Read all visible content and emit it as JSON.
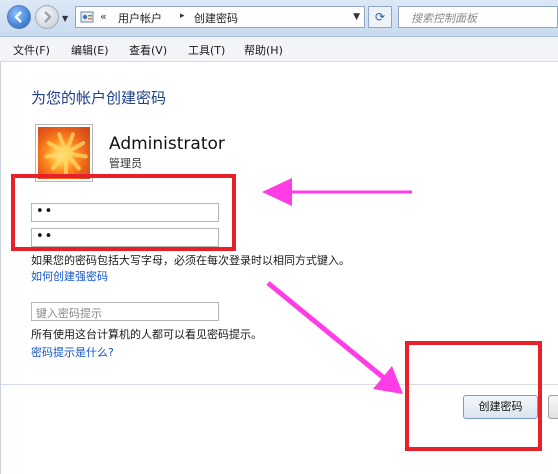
{
  "address_bar": {
    "chevron": "«",
    "breadcrumbs": [
      "用户帐户",
      "创建密码"
    ],
    "separator": "▸",
    "dropdown_icon": "chevron-down-icon"
  },
  "search": {
    "placeholder": "搜索控制面板"
  },
  "menu": {
    "items": [
      "文件(F)",
      "编辑(E)",
      "查看(V)",
      "工具(T)",
      "帮助(H)"
    ]
  },
  "page": {
    "title": "为您的帐户创建密码",
    "user": {
      "name": "Administrator",
      "role": "管理员"
    },
    "password_fields": [
      {
        "value": "••"
      },
      {
        "value": "••"
      }
    ],
    "case_note": "如果您的密码包括大写字母，必须在每次登录时以相同方式键入。",
    "strong_password_link": "如何创建强密码",
    "hint_placeholder": "键入密码提示",
    "hint_note": "所有使用这台计算机的人都可以看见密码提示。",
    "hint_link": "密码提示是什么?",
    "create_button": "创建密码"
  },
  "annotations": {
    "box_color": "#e8202a",
    "arrow_color": "#ff3ce6"
  }
}
